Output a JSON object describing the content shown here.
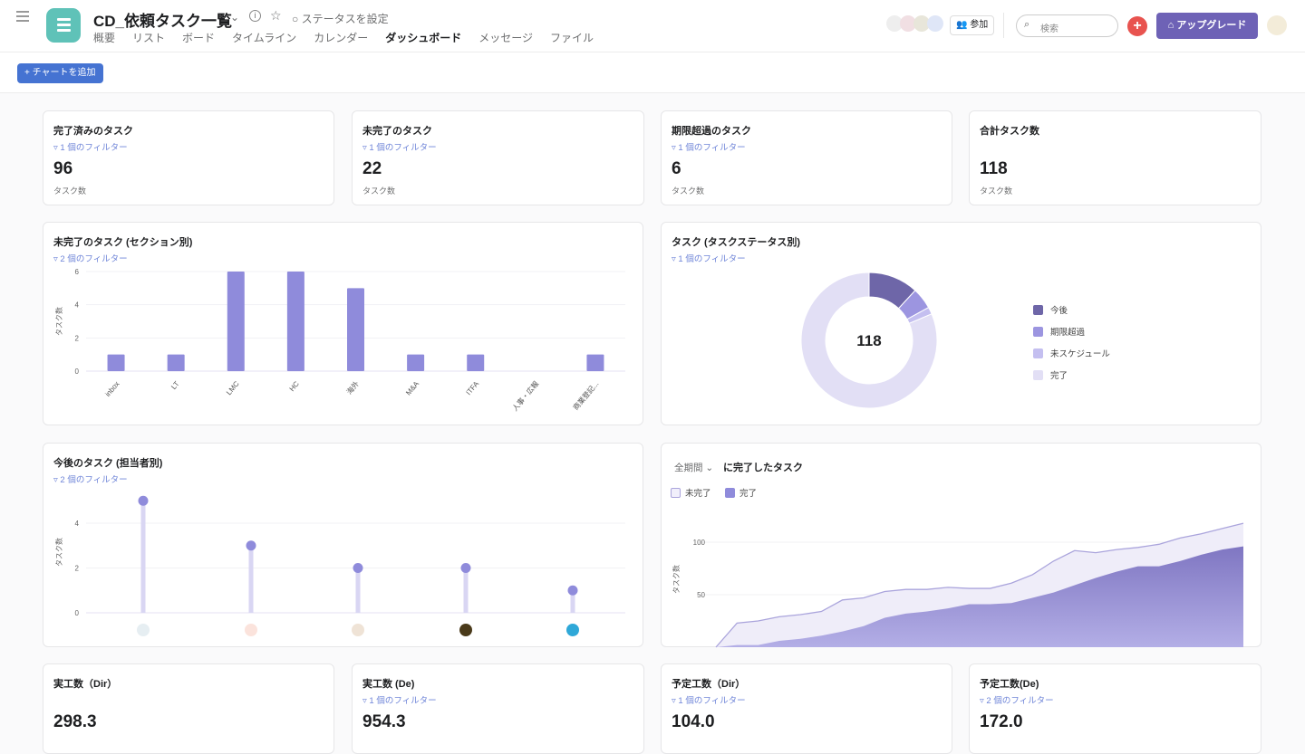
{
  "header": {
    "title": "CD_依頼タスク一覧",
    "status": "ステータスを設定",
    "tabs": [
      "概要",
      "リスト",
      "ボード",
      "タイムライン",
      "カレンダー",
      "ダッシュボード",
      "メッセージ",
      "ファイル"
    ],
    "active_tab": 5,
    "join": "参加",
    "search_placeholder": "検索",
    "upgrade": "アップグレード"
  },
  "toolbar": {
    "add_chart": "+ チャートを追加"
  },
  "stats": [
    {
      "title": "完了済みのタスク",
      "filter": "▿ 1 個のフィルター",
      "value": "96",
      "unit": "タスク数"
    },
    {
      "title": "未完了のタスク",
      "filter": "▿ 1 個のフィルター",
      "value": "22",
      "unit": "タスク数"
    },
    {
      "title": "期限超過のタスク",
      "filter": "▿ 1 個のフィルター",
      "value": "6",
      "unit": "タスク数"
    },
    {
      "title": "合計タスク数",
      "filter": "",
      "value": "118",
      "unit": "タスク数"
    }
  ],
  "stats2": [
    {
      "title": "実工数（Dir）",
      "filter": "",
      "value": "298.3"
    },
    {
      "title": "実工数 (De)",
      "filter": "▿ 1 個のフィルター",
      "value": "954.3"
    },
    {
      "title": "予定工数（Dir）",
      "filter": "▿ 1 個のフィルター",
      "value": "104.0"
    },
    {
      "title": "予定工数(De)",
      "filter": "▿ 2 個のフィルター",
      "value": "172.0"
    }
  ],
  "chart_data": [
    {
      "type": "bar",
      "title": "未完了のタスク (セクション別)",
      "filter": "▿ 2 個のフィルター",
      "ylabel": "タスク数",
      "ylim": [
        0,
        6
      ],
      "yticks": [
        0,
        2,
        4,
        6
      ],
      "categories": [
        "inbox",
        "LT",
        "LMC",
        "HC",
        "海外",
        "M&A",
        "ITFA",
        "人事・広報",
        "商業登記..."
      ],
      "values": [
        1,
        1,
        6,
        6,
        5,
        1,
        1,
        0,
        1
      ],
      "color": "#8f8bdb"
    },
    {
      "type": "pie",
      "title": "タスク (タスクステータス別)",
      "filter": "▿ 1 個のフィルター",
      "center_label": "118",
      "labels": [
        "今後",
        "期限超過",
        "未スケジュール",
        "完了"
      ],
      "values": [
        14,
        6,
        2,
        96
      ],
      "colors": [
        "#6e66a8",
        "#9c95e0",
        "#c4bff0",
        "#e2dff5"
      ]
    },
    {
      "type": "scatter",
      "subtype": "lollipop",
      "title": "今後のタスク (担当者別)",
      "filter": "▿ 2 個のフィルター",
      "ylabel": "タスク数",
      "ylim": [
        0,
        5
      ],
      "yticks": [
        0,
        2,
        4
      ],
      "values": [
        5,
        3,
        2,
        2,
        1
      ],
      "color": "#8f8bdb"
    },
    {
      "type": "area",
      "period": "全期間",
      "title": "に完了したタスク",
      "ylabel": "タスク数",
      "yticks": [
        50,
        100
      ],
      "ylim": [
        0,
        120
      ],
      "series": [
        {
          "name": "未完了",
          "values": [
            0,
            23,
            25,
            29,
            31,
            34,
            45,
            47,
            53,
            55,
            55,
            57,
            56,
            56,
            61,
            69,
            82,
            92,
            90,
            93,
            95,
            98,
            104,
            108,
            113,
            118
          ]
        },
        {
          "name": "完了",
          "values": [
            0,
            2,
            2,
            6,
            8,
            11,
            15,
            20,
            28,
            32,
            34,
            37,
            41,
            41,
            42,
            47,
            52,
            59,
            66,
            72,
            77,
            77,
            82,
            88,
            93,
            96
          ]
        }
      ]
    }
  ]
}
